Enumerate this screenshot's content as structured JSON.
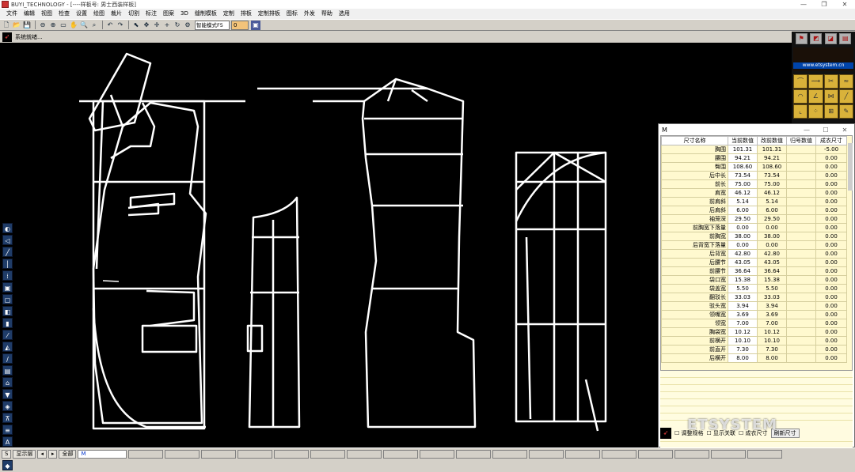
{
  "window": {
    "title": "BUYI_TECHNOLOGY - [----样板号: 男士西装样板]",
    "controls": [
      "—",
      "❐",
      "✕"
    ]
  },
  "menu": [
    "文件",
    "编辑",
    "视图",
    "检查",
    "设置",
    "绘图",
    "裁片",
    "切割",
    "标注",
    "图案",
    "3D",
    "缝制模板",
    "定制",
    "排板",
    "定制排板",
    "图标",
    "外发",
    "帮助",
    "选用"
  ],
  "toolbar": {
    "icons": [
      "new-icon",
      "open-icon",
      "save-icon",
      "zoom-out-icon",
      "zoom-in-icon",
      "fit-icon",
      "pan-icon",
      "zoom-window-icon",
      "zoom-extent-icon",
      "undo-icon",
      "redo-icon",
      "select-icon",
      "move-icon",
      "cross-icon",
      "add-point-icon",
      "rotate-icon",
      "settings-icon"
    ],
    "mode_select": "智能模式F5",
    "step_value": "0"
  },
  "status": {
    "text": "系统就绪..."
  },
  "right_panel": {
    "site": "www.etsystem.cn"
  },
  "size_window": {
    "title": "M",
    "headers": [
      "尺寸名称",
      "当前数值",
      "改前数值",
      "归号数值",
      "成衣尺寸"
    ],
    "rows": [
      [
        "胸围",
        "101.31",
        "101.31",
        "",
        "-5.00"
      ],
      [
        "腰围",
        "94.21",
        "94.21",
        "",
        "0.00"
      ],
      [
        "臀围",
        "108.60",
        "108.60",
        "",
        "0.00"
      ],
      [
        "后中长",
        "73.54",
        "73.54",
        "",
        "0.00"
      ],
      [
        "前长",
        "75.00",
        "75.00",
        "",
        "0.00"
      ],
      [
        "肩宽",
        "46.12",
        "46.12",
        "",
        "0.00"
      ],
      [
        "前肩斜",
        "5.14",
        "5.14",
        "",
        "0.00"
      ],
      [
        "后肩斜",
        "6.00",
        "6.00",
        "",
        "0.00"
      ],
      [
        "袖笼深",
        "29.50",
        "29.50",
        "",
        "0.00"
      ],
      [
        "前胸宽下落量",
        "0.00",
        "0.00",
        "",
        "0.00"
      ],
      [
        "前胸宽",
        "38.00",
        "38.00",
        "",
        "0.00"
      ],
      [
        "后背宽下落量",
        "0.00",
        "0.00",
        "",
        "0.00"
      ],
      [
        "后背宽",
        "42.80",
        "42.80",
        "",
        "0.00"
      ],
      [
        "后腰节",
        "43.05",
        "43.05",
        "",
        "0.00"
      ],
      [
        "前腰节",
        "36.64",
        "36.64",
        "",
        "0.00"
      ],
      [
        "袋口宽",
        "15.38",
        "15.38",
        "",
        "0.00"
      ],
      [
        "袋盖宽",
        "5.50",
        "5.50",
        "",
        "0.00"
      ],
      [
        "翻驳长",
        "33.03",
        "33.03",
        "",
        "0.00"
      ],
      [
        "驳头宽",
        "3.94",
        "3.94",
        "",
        "0.00"
      ],
      [
        "领嘴宽",
        "3.69",
        "3.69",
        "",
        "0.00"
      ],
      [
        "领宽",
        "7.00",
        "7.00",
        "",
        "0.00"
      ],
      [
        "胸袋宽",
        "10.12",
        "10.12",
        "",
        "0.00"
      ],
      [
        "前横开",
        "10.10",
        "10.10",
        "",
        "0.00"
      ],
      [
        "前直开",
        "7.30",
        "7.30",
        "",
        "0.00"
      ],
      [
        "后横开",
        "8.00",
        "8.00",
        "",
        "0.00"
      ]
    ],
    "footer": {
      "check1": "调整规格",
      "check2": "显示关联",
      "check3": "成衣尺寸",
      "button": "刷新尺寸"
    }
  },
  "bottom": {
    "s_label": "S",
    "layer": "显示层",
    "all": "全部",
    "active_size": "M"
  },
  "watermark": "ETSYSTEM"
}
